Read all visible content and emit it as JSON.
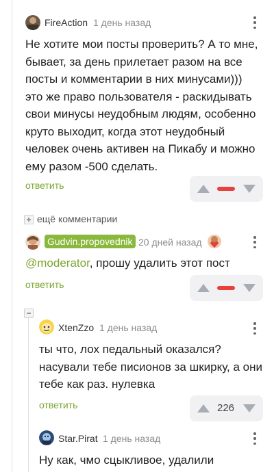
{
  "comments": [
    {
      "author": "FireAction",
      "time": "1 день назад",
      "text_lines": [
        "Не хотите мои посты проверить? А то мне,",
        "бывает, за день прилетает разом на все",
        "посты и комментарии в них минусами)))",
        "это же право пользователя - раскидывать",
        "свои минусы неудобным людям, особенно",
        "круто выходит, когда этот неудобный",
        "человек очень активен на Пикабу и можно",
        "ему разом -500 сделать."
      ],
      "reply": "ответить"
    },
    {
      "author": "Gudvin.propovednik",
      "time": "20 дней назад",
      "mention": "@moderator",
      "text_rest": ", прошу удалить этот пост",
      "reply": "ответить"
    },
    {
      "author": "XtenZzo",
      "time": "1 день назад",
      "text_lines": [
        "ты что, лох педальный оказался?",
        "насували тебе писионов за шкирку, а они",
        "тебе как раз. нулевка"
      ],
      "reply": "ответить",
      "score": "226"
    },
    {
      "author": "Star.Pirat",
      "time": "1 день назад",
      "text_lines": [
        "Ну как, чмо сцыкливое, удалили"
      ]
    }
  ],
  "more_comments": "ещё комментарии",
  "colors": {
    "accent_green": "#8ab83c",
    "reply_green": "#7ba52f",
    "minus_red": "#e4413f"
  }
}
